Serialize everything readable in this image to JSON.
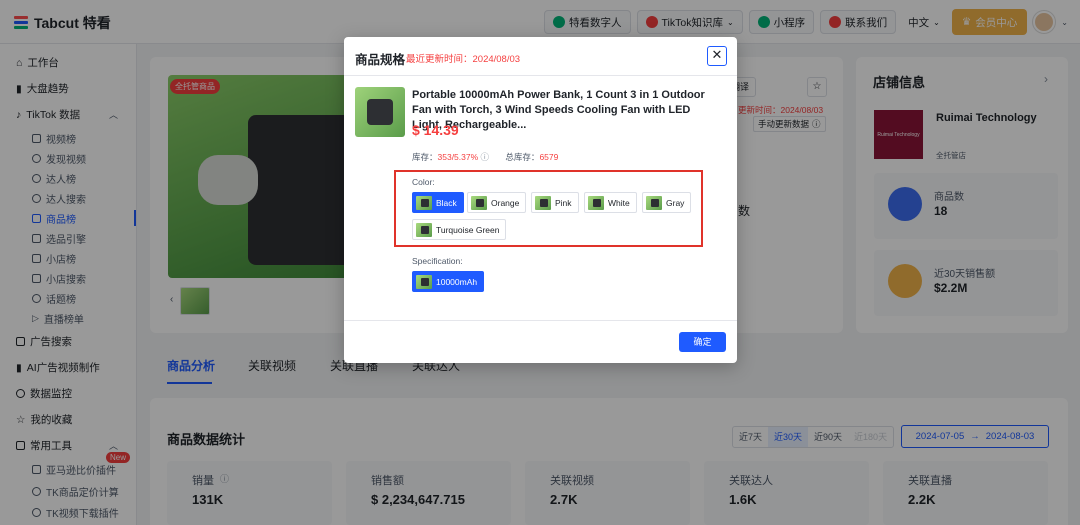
{
  "app": {
    "name": "Tabcut 特看"
  },
  "topbar": {
    "pills": [
      "特看数字人",
      "TikTok知识库",
      "小程序",
      "联系我们"
    ],
    "language": "中文",
    "vip_label": "会员中心"
  },
  "sidebar": {
    "items": [
      {
        "label": "工作台"
      },
      {
        "label": "大盘趋势"
      },
      {
        "label": "TikTok 数据"
      }
    ],
    "tiktok_sub": [
      "视频榜",
      "发现视频",
      "达人榜",
      "达人搜索",
      "商品榜",
      "选品引擎",
      "小店榜",
      "小店搜索",
      "话题榜",
      "直播榜单"
    ],
    "items2": [
      "广告搜索",
      "AI广告视频制作",
      "数据监控",
      "我的收藏",
      "常用工具"
    ],
    "tools_sub": [
      "亚马逊比价插件",
      "TK商品定价计算",
      "TK视频下载插件"
    ],
    "new_badge": "New"
  },
  "product_card": {
    "badge": "全托管商品",
    "translate_label": "翻译",
    "update_time": "更新时间：2024/08/03",
    "manual_update": "手动更新数据"
  },
  "store": {
    "title": "店铺信息",
    "name": "Ruimai Technology",
    "logo_text": "Ruimai Technology",
    "tag": "全托管店",
    "product_count_label": "商品数",
    "product_count": "18",
    "sales_label": "近30天销售额",
    "sales_value": "$2.2M"
  },
  "tabs": [
    "商品分析",
    "关联视频",
    "关联直播",
    "关联达人"
  ],
  "stats": {
    "title": "商品数据统计",
    "periods": [
      "近7天",
      "近30天",
      "近90天",
      "近180天"
    ],
    "date_from": "2024-07-05",
    "date_arrow": "→",
    "date_to": "2024-08-03",
    "cards": [
      {
        "label": "销量",
        "value": "131K"
      },
      {
        "label": "销售额",
        "value": "$ 2,234,647.715"
      },
      {
        "label": "关联视频",
        "value": "2.7K"
      },
      {
        "label": "关联达人",
        "value": "1.6K"
      },
      {
        "label": "关联直播",
        "value": "2.2K"
      }
    ]
  },
  "modal": {
    "title": "商品规格",
    "subtitle": "最近更新时间：2024/08/03",
    "close": "✕",
    "product_name": "Portable 10000mAh Power Bank, 1 Count 3 in 1 Outdoor Fan with Torch, 3 Wind Speeds Cooling Fan with LED Light, Rechargeable...",
    "price": "$ 14.39",
    "stock_label": "库存：",
    "stock_value": "353/5.37%",
    "total_stock_label": "总库存：",
    "total_stock_value": "6579",
    "color_label": "Color:",
    "colors": [
      "Black",
      "Orange",
      "Pink",
      "White",
      "Gray",
      "Turquoise Green"
    ],
    "selected_color": "Black",
    "spec_label": "Specification:",
    "specs": [
      "10000mAh"
    ],
    "confirm": "确定"
  },
  "partial_text": {
    "count_fragment": "数"
  },
  "colors": {
    "accent": "#1f5bff",
    "price_red": "#f53f3f",
    "highlight_border": "#e0332a",
    "vip": "#f0b24a"
  }
}
